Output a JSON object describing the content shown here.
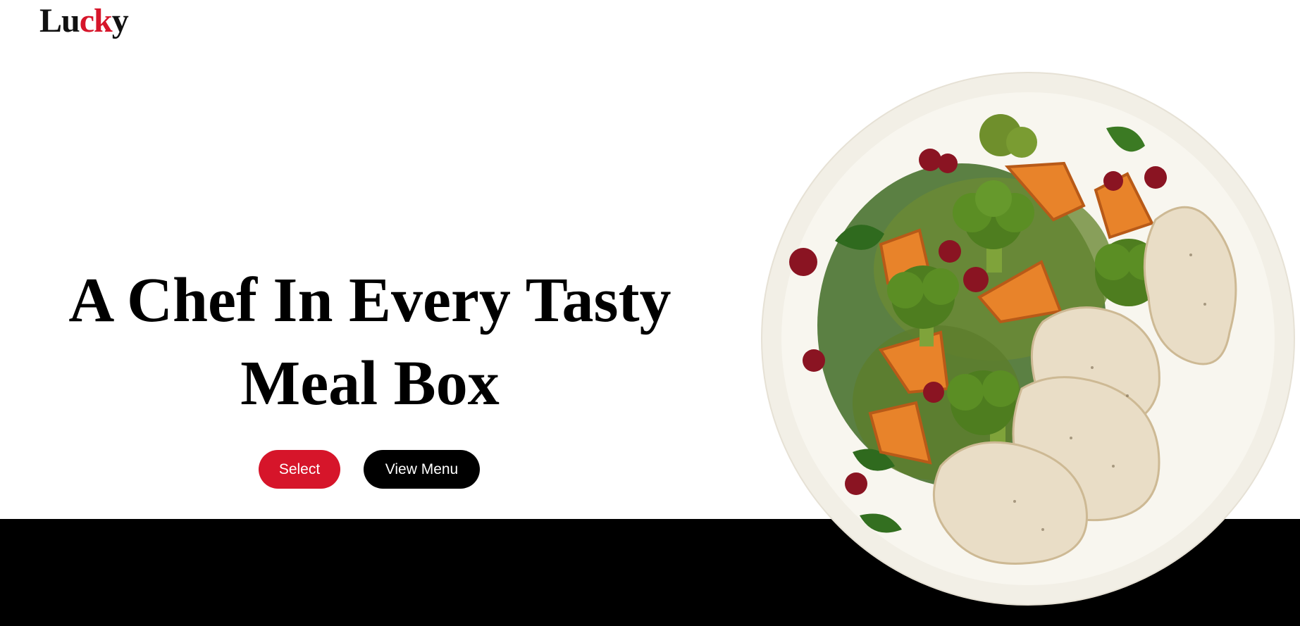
{
  "brand": {
    "logo_part1": "Lu",
    "logo_part2": "ck",
    "logo_part3": "y"
  },
  "hero": {
    "title_line1": "A Chef In Every Tasty",
    "title_line2": "Meal Box"
  },
  "buttons": {
    "select_label": "Select",
    "view_menu_label": "View Menu"
  },
  "colors": {
    "accent": "#d6152a",
    "dark": "#000000",
    "background": "#ffffff"
  },
  "image": {
    "subject": "plate-of-roasted-vegetables-and-chicken"
  }
}
